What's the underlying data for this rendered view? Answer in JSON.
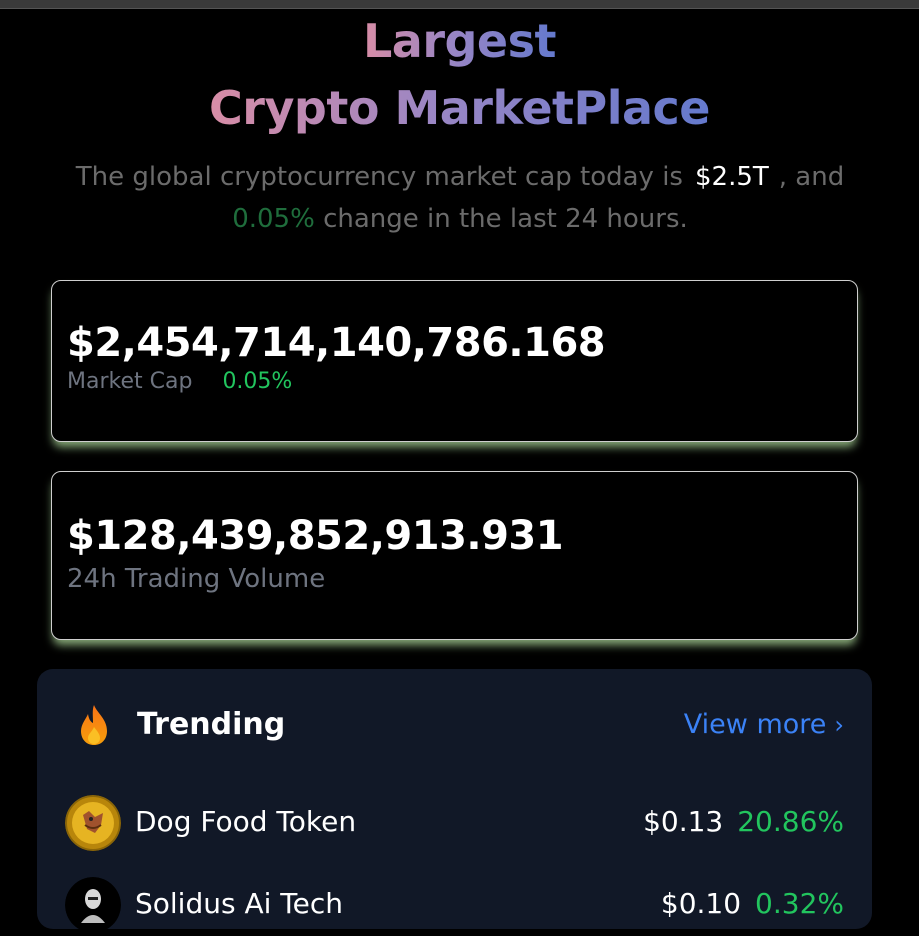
{
  "hero": {
    "title_line1": "Largest",
    "title_line2": "Crypto MarketPlace",
    "subtitle_prefix": "The global cryptocurrency market cap today is",
    "subtitle_cap": "$2.5T",
    "subtitle_mid": ", and",
    "subtitle_pct": "0.05%",
    "subtitle_suffix": "change in the last 24 hours."
  },
  "market_cap": {
    "value": "$2,454,714,140,786.168",
    "label": "Market Cap",
    "change": "0.05%"
  },
  "volume": {
    "value": "$128,439,852,913.931",
    "label": "24h Trading Volume"
  },
  "trending": {
    "icon": "fire-icon",
    "title": "Trending",
    "view_more": "View more",
    "coins": [
      {
        "name": "Dog Food Token",
        "price": "$0.13",
        "change": "20.86%"
      },
      {
        "name": "Solidus Ai Tech",
        "price": "$0.10",
        "change": "0.32%"
      }
    ]
  },
  "colors": {
    "accent_blue": "#3b82f6",
    "positive_green": "#22c55e",
    "panel_bg": "#111827"
  }
}
